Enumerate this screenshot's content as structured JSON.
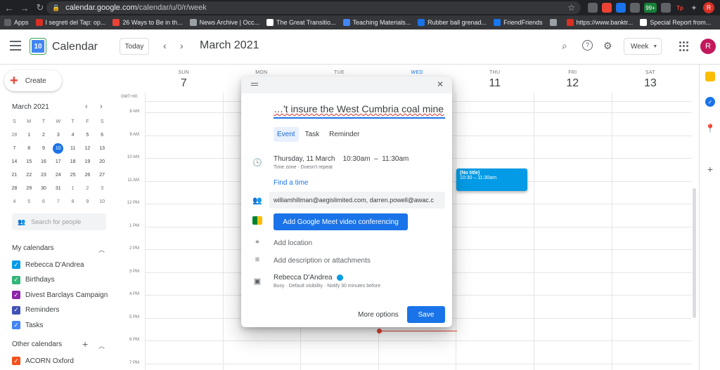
{
  "browser": {
    "url_host": "calendar.google.com",
    "url_path": "/calendar/u/0/r/week",
    "bookmarks": [
      {
        "label": "Apps",
        "color": "#5f6368"
      },
      {
        "label": "I segreti del Tap: op...",
        "color": "#d93025"
      },
      {
        "label": "26 Ways to Be in th...",
        "color": "#ea4335"
      },
      {
        "label": "News Archive | Occ...",
        "color": "#9aa0a6"
      },
      {
        "label": "The Great Transitio...",
        "color": "#ffffff"
      },
      {
        "label": "Teaching Materials...",
        "color": "#4285f4"
      },
      {
        "label": "Rubber ball grenad...",
        "color": "#1a73e8"
      },
      {
        "label": "FriendFriends",
        "color": "#1877f2"
      },
      {
        "label": "",
        "color": "#9aa0a6"
      },
      {
        "label": "https://www.banktr...",
        "color": "#d93025"
      },
      {
        "label": "Special Report from...",
        "color": "#ffffff"
      }
    ],
    "badge": "99+",
    "profile_initial": "R"
  },
  "header": {
    "brand": "Calendar",
    "logo_day": "10",
    "today": "Today",
    "month": "March 2021",
    "view": "Week",
    "avatar": "R"
  },
  "sidebar": {
    "create": "Create",
    "mini_month": "March 2021",
    "dows": [
      "S",
      "M",
      "T",
      "W",
      "T",
      "F",
      "S"
    ],
    "weeks": [
      [
        "28",
        "1",
        "2",
        "3",
        "4",
        "5",
        "6"
      ],
      [
        "7",
        "8",
        "9",
        "10",
        "11",
        "12",
        "13"
      ],
      [
        "14",
        "15",
        "16",
        "17",
        "18",
        "19",
        "20"
      ],
      [
        "21",
        "22",
        "23",
        "24",
        "25",
        "26",
        "27"
      ],
      [
        "28",
        "29",
        "30",
        "31",
        "1",
        "2",
        "3"
      ],
      [
        "4",
        "5",
        "6",
        "7",
        "8",
        "9",
        "10"
      ]
    ],
    "today_day": "10",
    "search_people": "Search for people",
    "my_calendars_title": "My calendars",
    "my_calendars": [
      {
        "label": "Rebecca D'Andrea",
        "color": "#039be5"
      },
      {
        "label": "Birthdays",
        "color": "#33b679"
      },
      {
        "label": "Divest Barclays Campaign",
        "color": "#8e24aa"
      },
      {
        "label": "Reminders",
        "color": "#3f51b5"
      },
      {
        "label": "Tasks",
        "color": "#4285f4"
      }
    ],
    "other_calendars_title": "Other calendars",
    "other_calendars": [
      {
        "label": "ACORN Oxford",
        "color": "#f4511e"
      }
    ]
  },
  "week": {
    "days": [
      {
        "dow": "SUN",
        "num": "7"
      },
      {
        "dow": "MON",
        "num": "8"
      },
      {
        "dow": "TUE",
        "num": "9"
      },
      {
        "dow": "WED",
        "num": "10"
      },
      {
        "dow": "THU",
        "num": "11"
      },
      {
        "dow": "FRI",
        "num": "12"
      },
      {
        "dow": "SAT",
        "num": "13"
      }
    ],
    "timezone": "GMT+00",
    "hours": [
      "8 AM",
      "9 AM",
      "10 AM",
      "11 AM",
      "12 PM",
      "1 PM",
      "2 PM",
      "3 PM",
      "4 PM",
      "5 PM",
      "6 PM",
      "7 PM"
    ],
    "event": {
      "title": "(No title)",
      "time": "10:30 – 11:30am"
    }
  },
  "dialog": {
    "title_value": "…'t insure the West Cumbria coal mine",
    "tabs": [
      "Event",
      "Task",
      "Reminder"
    ],
    "active_tab": "Event",
    "date": "Thursday, 11 March",
    "start": "10:30am",
    "dash": "–",
    "end": "11:30am",
    "tz_repeat": "Time zone · Doesn't repeat",
    "find_time": "Find a time",
    "guests": "williamhillman@aegislimited.com, darren.powell@awac.c",
    "meet": "Add Google Meet video conferencing",
    "location": "Add location",
    "description": "Add description or attachments",
    "owner": "Rebecca D'Andrea",
    "owner_meta": "Busy · Default visibility · Notify 30 minutes before",
    "more_options": "More options",
    "save": "Save"
  }
}
